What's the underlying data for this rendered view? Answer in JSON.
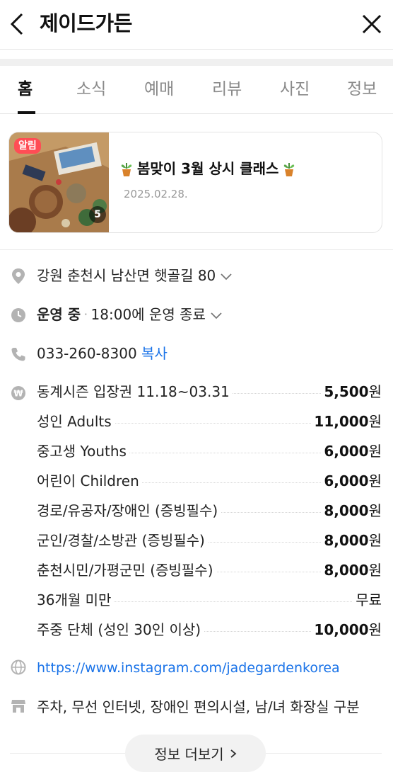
{
  "header": {
    "title": "제이드가든"
  },
  "tabs": [
    {
      "label": "홈"
    },
    {
      "label": "소식"
    },
    {
      "label": "예매"
    },
    {
      "label": "리뷰"
    },
    {
      "label": "사진"
    },
    {
      "label": "정보"
    }
  ],
  "notice": {
    "badge": "알림",
    "photo_count": "5",
    "title": "봄맞이 3월 상시 클래스",
    "date": "2025.02.28."
  },
  "info": {
    "address": "강원 춘천시 남산면 햇골길 80",
    "status": "운영 중",
    "hours": "18:00에 운영 종료",
    "phone": "033-260-8300",
    "copy_label": "복사",
    "prices": [
      {
        "name": "동계시즌 입장권 11.18~03.31",
        "num": "5,500",
        "unit": "원"
      },
      {
        "name": "성인 Adults",
        "num": "11,000",
        "unit": "원"
      },
      {
        "name": "중고생 Youths",
        "num": "6,000",
        "unit": "원"
      },
      {
        "name": "어린이 Children",
        "num": "6,000",
        "unit": "원"
      },
      {
        "name": "경로/유공자/장애인 (증빙필수)",
        "num": "8,000",
        "unit": "원"
      },
      {
        "name": "군인/경찰/소방관 (증빙필수)",
        "num": "8,000",
        "unit": "원"
      },
      {
        "name": "춘천시민/가평군민 (증빙필수)",
        "num": "8,000",
        "unit": "원"
      },
      {
        "name": "36개월 미만",
        "num": "",
        "unit": "무료"
      },
      {
        "name": "주중 단체 (성인 30인 이상)",
        "num": "10,000",
        "unit": "원"
      }
    ],
    "website": "https://www.instagram.com/jadegardenkorea",
    "amenities": "주차, 무선 인터넷, 장애인 편의시설, 남/녀 화장실 구분"
  },
  "more_button": {
    "label": "정보 더보기"
  },
  "colors": {
    "accent_blue": "#1a73e8",
    "badge_red": "#ff4d55",
    "icon_gray": "#b3b3b3"
  }
}
